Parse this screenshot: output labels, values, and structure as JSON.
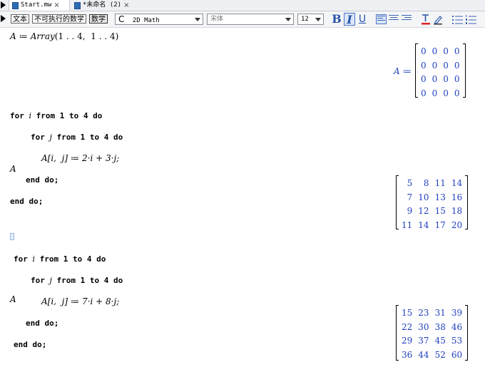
{
  "tabs": [
    {
      "label": "Start.mw",
      "close": "×"
    },
    {
      "label": "*未命名 (2)",
      "close": "×"
    }
  ],
  "toolbar": {
    "text_mode": "文本",
    "nonexec_math": "不可执行的数学",
    "math_mode": "数学",
    "style_letter": "C",
    "style_value": "2D Math",
    "font_value": "宋体",
    "size_value": "12",
    "bold": "B",
    "italic": "I",
    "underline": "U"
  },
  "doc": {
    "input1": {
      "lhs": "A",
      "op": " ≔ ",
      "fn": "Array",
      "args": "(1 . . 4,  1 . . 4)"
    },
    "output1_label": "A ≔",
    "matrix1": [
      [
        "0",
        "0",
        "0",
        "0"
      ],
      [
        "0",
        "0",
        "0",
        "0"
      ],
      [
        "0",
        "0",
        "0",
        "0"
      ],
      [
        "0",
        "0",
        "0",
        "0"
      ]
    ],
    "loop1": {
      "l1_a": "for ",
      "l1_v": "i",
      "l1_b": " from 1 to 4 do",
      "l2_a": "for ",
      "l2_v": "j",
      "l2_b": " from 1 to 4 do",
      "l3": "A[i,  j] ≔ 2·i + 3·j;",
      "l4": "end do;",
      "l5": "end do;"
    },
    "eval1": "A",
    "matrix2": [
      [
        "5",
        "8",
        "11",
        "14"
      ],
      [
        "7",
        "10",
        "13",
        "16"
      ],
      [
        "9",
        "12",
        "15",
        "18"
      ],
      [
        "11",
        "14",
        "17",
        "20"
      ]
    ],
    "loop2": {
      "l1_a": "for ",
      "l1_v": "i",
      "l1_b": " from 1 to 4 do",
      "l2_a": "for ",
      "l2_v": "j",
      "l2_b": " from 1 to 4 do",
      "l3": "A[i,  j] ≔ 7·i + 8·j;",
      "l4": "end do;",
      "l5": "end do;"
    },
    "eval2": "A",
    "matrix3": [
      [
        "15",
        "23",
        "31",
        "39"
      ],
      [
        "22",
        "30",
        "38",
        "46"
      ],
      [
        "29",
        "37",
        "45",
        "53"
      ],
      [
        "36",
        "44",
        "52",
        "60"
      ]
    ]
  }
}
